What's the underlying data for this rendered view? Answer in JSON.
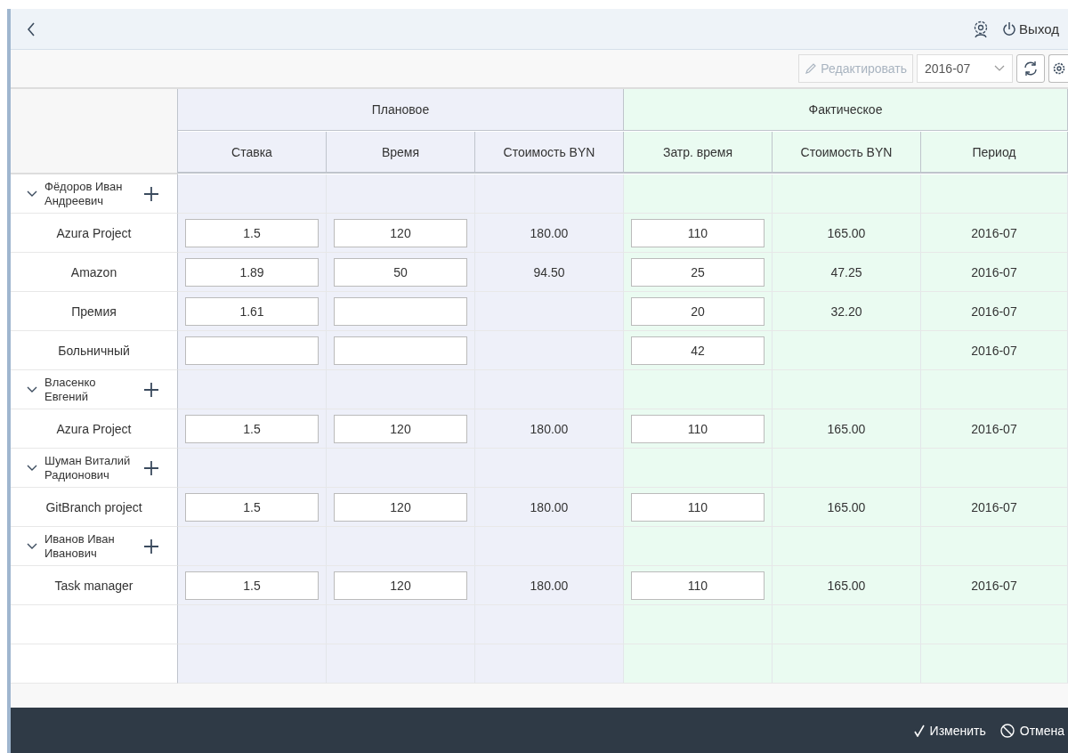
{
  "header": {
    "logout": "Выход"
  },
  "toolbar": {
    "edit": {
      "label": "Редактировать",
      "disabled": true
    },
    "period": "2016-07"
  },
  "table": {
    "groups": [
      {
        "label": "Плановое",
        "kind": "plan"
      },
      {
        "label": "Фактическое",
        "kind": "fact"
      }
    ],
    "columns": [
      {
        "label": "Ставка",
        "kind": "plan"
      },
      {
        "label": "Время",
        "kind": "plan"
      },
      {
        "label": "Стоимость BYN",
        "kind": "plan"
      },
      {
        "label": "Затр. время",
        "kind": "fact"
      },
      {
        "label": "Стоимость BYN",
        "kind": "fact"
      },
      {
        "label": "Период",
        "kind": "fact"
      }
    ],
    "employees": [
      {
        "name": "Фёдоров Иван Андреевич",
        "expanded": true,
        "children": [
          {
            "project": "Azura Project",
            "rate": "1.5",
            "time": "120",
            "cost": "180.00",
            "fact_time": "110",
            "fact_cost": "165.00",
            "period": "2016-07"
          },
          {
            "project": "Amazon",
            "rate": "1.89",
            "time": "50",
            "cost": "94.50",
            "fact_time": "25",
            "fact_cost": "47.25",
            "period": "2016-07"
          },
          {
            "project": "Премия",
            "rate": "1.61",
            "fact_time": "20",
            "fact_cost": "32.20",
            "period": "2016-07"
          },
          {
            "project": "Больничный",
            "fact_time": "42",
            "period": "2016-07"
          }
        ]
      },
      {
        "name": "Власенко Евгений",
        "expanded": true,
        "children": [
          {
            "project": "Azura Project",
            "rate": "1.5",
            "time": "120",
            "cost": "180.00",
            "fact_time": "110",
            "fact_cost": "165.00",
            "period": "2016-07"
          }
        ]
      },
      {
        "name": "Шуман Виталий Радионович",
        "expanded": true,
        "children": [
          {
            "project": "GitBranch project",
            "rate": "1.5",
            "time": "120",
            "cost": "180.00",
            "fact_time": "110",
            "fact_cost": "165.00",
            "period": "2016-07"
          }
        ]
      },
      {
        "name": "Иванов Иван Иванович",
        "expanded": true,
        "children": [
          {
            "project": "Task manager",
            "rate": "1.5",
            "time": "120",
            "cost": "180.00",
            "fact_time": "110",
            "fact_cost": "165.00",
            "period": "2016-07"
          }
        ]
      }
    ]
  },
  "footer": {
    "apply": "Изменить",
    "cancel": "Отмена"
  }
}
